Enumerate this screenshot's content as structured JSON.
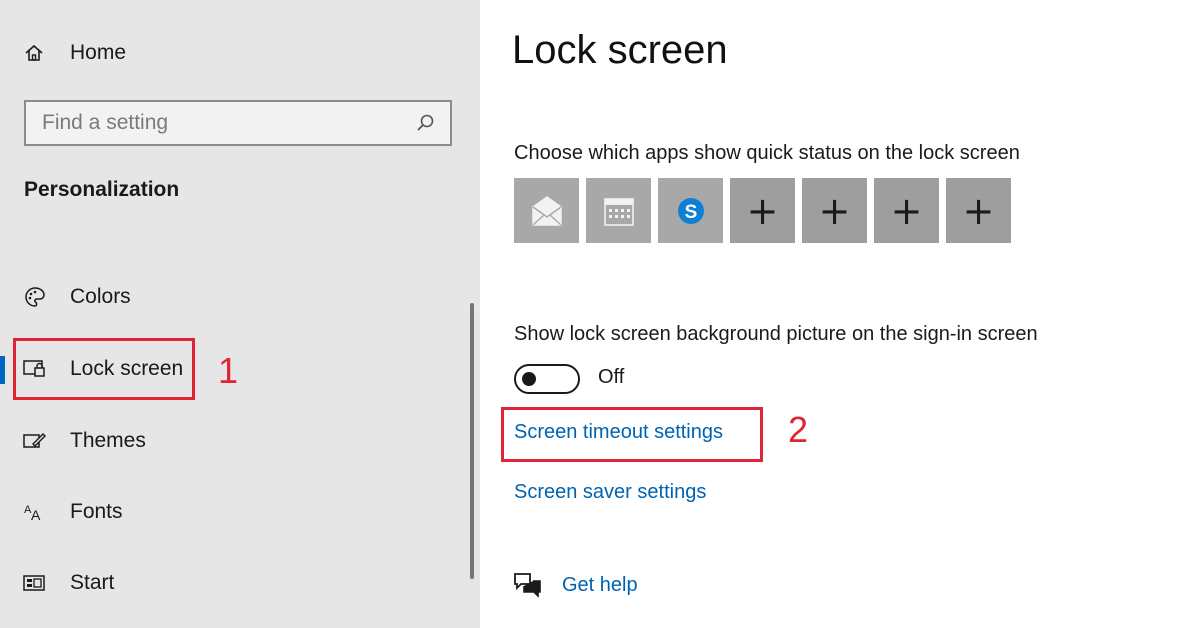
{
  "sidebar": {
    "home_label": "Home",
    "search_placeholder": "Find a setting",
    "section_title": "Personalization",
    "items": [
      {
        "label": "Colors",
        "icon": "palette-icon"
      },
      {
        "label": "Lock screen",
        "icon": "lock-screen-icon",
        "selected": true
      },
      {
        "label": "Themes",
        "icon": "themes-icon"
      },
      {
        "label": "Fonts",
        "icon": "fonts-icon"
      },
      {
        "label": "Start",
        "icon": "start-icon"
      }
    ]
  },
  "annotations": {
    "marker_1": "1",
    "marker_2": "2",
    "color": "#e02434"
  },
  "main": {
    "title": "Lock screen",
    "quick_status_label": "Choose which apps show quick status on the lock screen",
    "quick_status_tiles": [
      {
        "icon": "mail-icon"
      },
      {
        "icon": "calendar-icon"
      },
      {
        "icon": "skype-icon"
      },
      {
        "icon": "plus-icon",
        "text": "+"
      },
      {
        "icon": "plus-icon",
        "text": "+"
      },
      {
        "icon": "plus-icon",
        "text": "+"
      },
      {
        "icon": "plus-icon",
        "text": "+"
      }
    ],
    "background_picture_label": "Show lock screen background picture on the sign-in screen",
    "toggle_state": "Off",
    "links": {
      "screen_timeout": "Screen timeout settings",
      "screen_saver": "Screen saver settings",
      "get_help": "Get help"
    }
  },
  "colors": {
    "accent": "#0067c0",
    "link": "#0063b1",
    "sidebar_bg": "#e6e6e6"
  }
}
